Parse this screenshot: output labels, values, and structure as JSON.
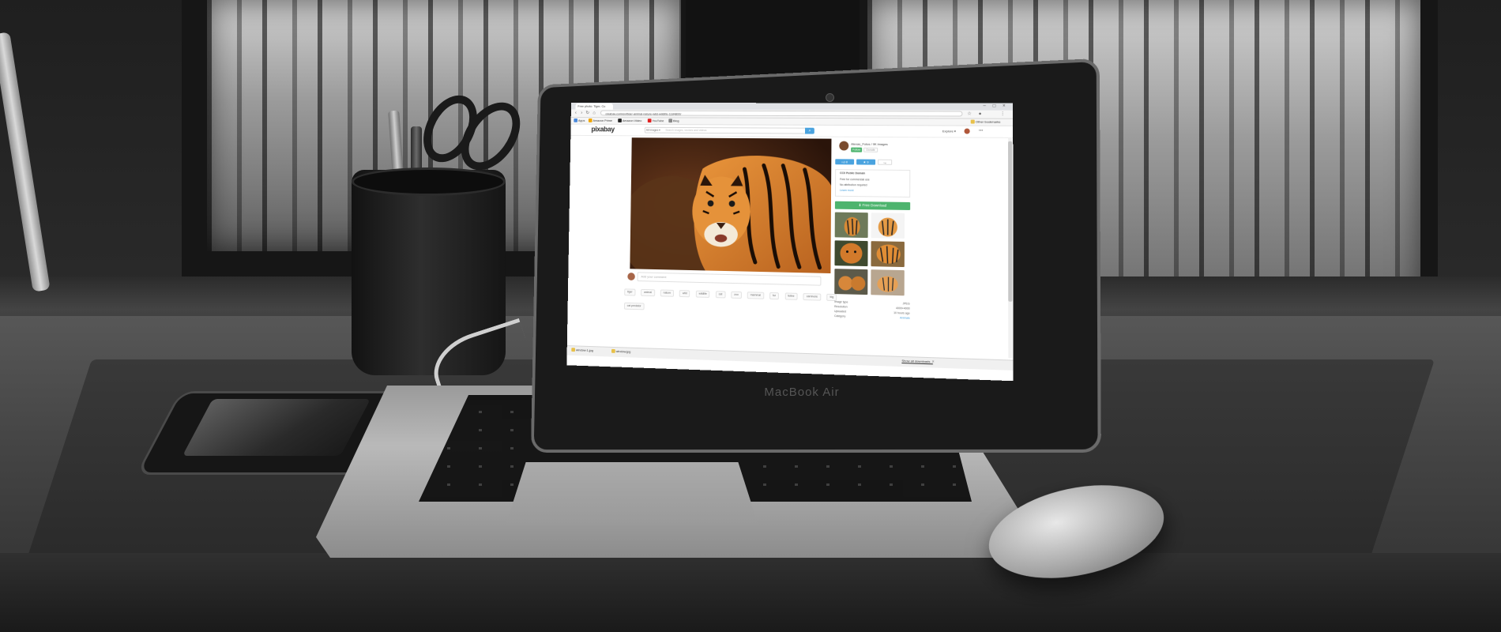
{
  "browser": {
    "tab_title": "Free photo: Tiger, Cu",
    "url": "pixabay.com/en/tiger-animal-nature-wild-wildlife-1184800/",
    "other_bookmarks": "Other bookmarks",
    "bookmarks": [
      {
        "label": "Apps",
        "color": "#4a89dc"
      },
      {
        "label": "Amazon Prime",
        "color": "#f0a500"
      },
      {
        "label": "Amazon Video",
        "color": "#222222"
      },
      {
        "label": "YouTube",
        "color": "#e02020"
      },
      {
        "label": "Blog",
        "color": "#888888"
      }
    ]
  },
  "site": {
    "logo": "pixabay",
    "search_category": "All Images ▾",
    "search_placeholder": "Search images, vectors and videos",
    "explore": "Explore ▾"
  },
  "image_page": {
    "author": "Alexas_Fotos / 9K images",
    "follow": "Follow",
    "donate": "Donate",
    "like_count": "8",
    "favorite_count": "9",
    "license_lines": [
      "CC0 Public Domain",
      "Free for commercial use",
      "No attribution required",
      "Learn more"
    ],
    "download_label": "⬇ Free Download",
    "comment_placeholder": "Add your comment",
    "tags": [
      "tiger",
      "animal",
      "nature",
      "wild",
      "wildlife",
      "cat",
      "zoo",
      "mammal",
      "fur",
      "feline",
      "carnivore",
      "big",
      "cat predator"
    ],
    "meta": [
      {
        "label": "Image type",
        "value": "JPEG"
      },
      {
        "label": "Resolution",
        "value": "4000×4000"
      },
      {
        "label": "Uploaded",
        "value": "10 hours ago"
      },
      {
        "label": "Category",
        "value": "Animals"
      }
    ]
  },
  "downloads": {
    "items": [
      "window-1.jpg",
      "window.jpg"
    ],
    "show_all": "Show all downloads..."
  },
  "device": {
    "lid_label": "MacBook Air"
  },
  "colors": {
    "accent_green": "#4db46e",
    "accent_blue": "#4aa3df",
    "tiger_orange": "#d9822b"
  }
}
